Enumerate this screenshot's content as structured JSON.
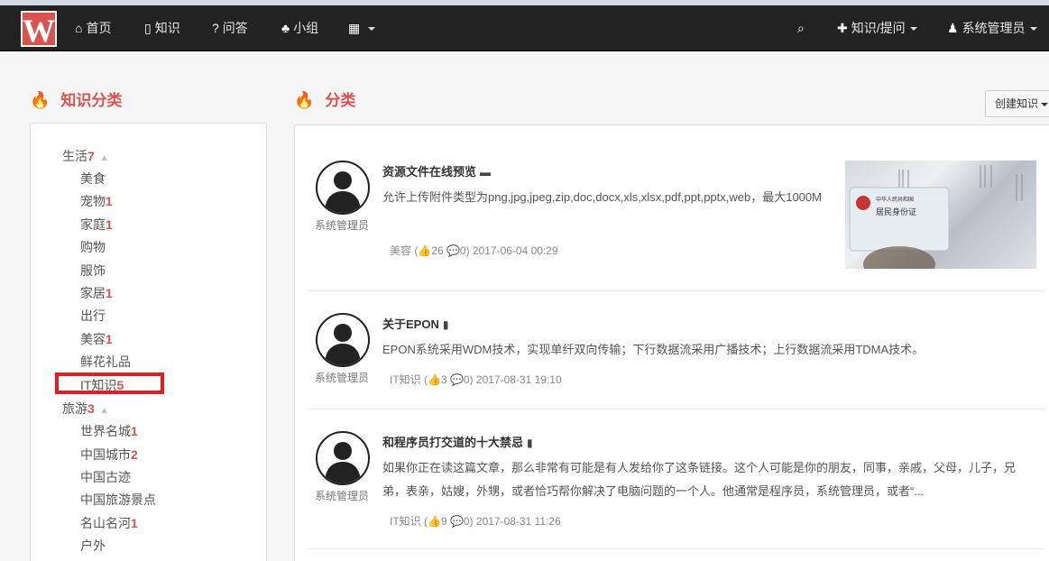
{
  "nav": {
    "logo": "W",
    "home": "首页",
    "knowledge": "知识",
    "qa": "问答",
    "group": "小组",
    "post": "知识/提问",
    "user": "系统管理员"
  },
  "sidebar_title": "知识分类",
  "main_title": "分类",
  "create_button": "创建知识",
  "categories": [
    {
      "name": "生活",
      "count": "7"
    },
    {
      "name": "美食",
      "count": ""
    },
    {
      "name": "宠物",
      "count": "1"
    },
    {
      "name": "家庭",
      "count": "1"
    },
    {
      "name": "购物",
      "count": ""
    },
    {
      "name": "服饰",
      "count": ""
    },
    {
      "name": "家居",
      "count": "1"
    },
    {
      "name": "出行",
      "count": ""
    },
    {
      "name": "美容",
      "count": "1"
    },
    {
      "name": "鲜花礼品",
      "count": ""
    },
    {
      "name": "IT知识",
      "count": "5"
    },
    {
      "name": "旅游",
      "count": "3"
    },
    {
      "name": "世界名城",
      "count": "1"
    },
    {
      "name": "中国城市",
      "count": "2"
    },
    {
      "name": "中国古迹",
      "count": ""
    },
    {
      "name": "中国旅游景点",
      "count": ""
    },
    {
      "name": "名山名河",
      "count": "1"
    },
    {
      "name": "户外",
      "count": ""
    }
  ],
  "items": [
    {
      "title": "资源文件在线预览",
      "desc": "允许上传附件类型为png,jpg,jpeg,zip,doc,docx,xls,xlsx,pdf,ppt,pptx,web，最大1000M",
      "author": "系统管理员",
      "meta": "美容 (👍26 💬0) 2017-06-04 00:29"
    },
    {
      "title": "关于EPON",
      "desc": "EPON系统采用WDM技术，实现单纤双向传输；下行数据流采用广播技术；上行数据流采用TDMA技术。",
      "author": "系统管理员",
      "meta": "IT知识 (👍3 💬0) 2017-08-31 19:10"
    },
    {
      "title": "和程序员打交道的十大禁忌",
      "desc": "如果你正在读这篇文章，那么非常有可能是有人发给你了这条链接。这个人可能是你的朋友，同事，亲戚，父母，儿子，兄弟，表亲，姑嫂，外甥，或者恰巧帮你解决了电脑问题的一个人。他通常是程序员，系统管理员，或者“...",
      "author": "系统管理员",
      "meta": "IT知识 (👍9 💬0) 2017-08-31 11:26"
    }
  ],
  "thumb_text": {
    "line1": "中华人民共和国",
    "line2": "居民身份证"
  }
}
